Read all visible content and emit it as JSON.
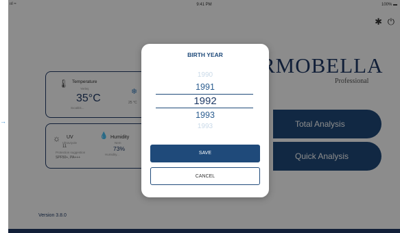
{
  "status_bar": {
    "signal": "ııl ≈",
    "time": "9:41 PM",
    "battery": "100% ▬"
  },
  "top_icons": {
    "settings": "✱",
    "power": "⏻"
  },
  "logo": {
    "text": "RMOBELLA",
    "sub": "Professional"
  },
  "temperature_card": {
    "label": "Temperature",
    "sub": "Yerleş",
    "value": "35°C",
    "note": "Sıcaklık...",
    "inside_value": "25 °C",
    "icon_thermo": "🌡",
    "icon_snow": "❄"
  },
  "uv_card": {
    "uv_label": "UV",
    "uv_sub": "Ultraviyole",
    "uv_value": "11",
    "uv_protection": "Protection suggestion",
    "uv_spf": "SPF50+, PA+++",
    "humidity_label": "Humidity",
    "humidity_sub": "Nem",
    "humidity_value": "73%",
    "humidity_note": "Humidity...",
    "icon_sun": "☼",
    "icon_drop": "💧"
  },
  "buttons": {
    "total": "Total Analysis",
    "quick": "Quick Analysis"
  },
  "version": "Version 3.8.0",
  "arrow": "→",
  "modal": {
    "title": "BIRTH YEAR",
    "years": [
      "1990",
      "1991",
      "1992",
      "1993",
      "1993"
    ],
    "selected_index": 2,
    "save": "SAVE",
    "cancel": "CANCEL"
  },
  "colors": {
    "primary": "#1f4a7a",
    "dark": "#1f3a66",
    "overlay": "rgba(0,0,0,0.45)"
  }
}
